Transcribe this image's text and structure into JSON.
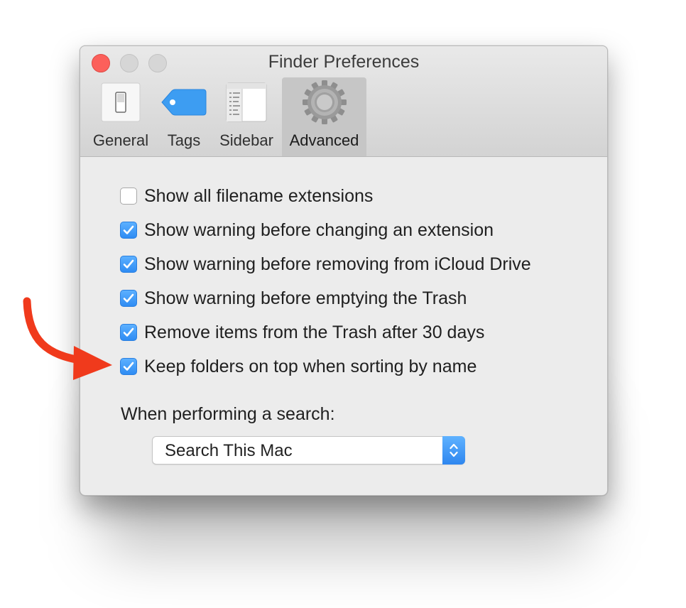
{
  "window": {
    "title": "Finder Preferences"
  },
  "tabs": [
    {
      "label": "General",
      "icon": "switch-icon",
      "selected": false
    },
    {
      "label": "Tags",
      "icon": "tag-icon",
      "selected": false
    },
    {
      "label": "Sidebar",
      "icon": "sidebar-icon",
      "selected": false
    },
    {
      "label": "Advanced",
      "icon": "gear-icon",
      "selected": true
    }
  ],
  "options": [
    {
      "label": "Show all filename extensions",
      "checked": false
    },
    {
      "label": "Show warning before changing an extension",
      "checked": true
    },
    {
      "label": "Show warning before removing from iCloud Drive",
      "checked": true
    },
    {
      "label": "Show warning before emptying the Trash",
      "checked": true
    },
    {
      "label": "Remove items from the Trash after 30 days",
      "checked": true
    },
    {
      "label": "Keep folders on top when sorting by name",
      "checked": true
    }
  ],
  "search": {
    "label": "When performing a search:",
    "selected_value": "Search This Mac"
  },
  "colors": {
    "accent": "#2f8cf3",
    "close_button": "#fc605b",
    "annotation_arrow": "#f03a1c"
  }
}
